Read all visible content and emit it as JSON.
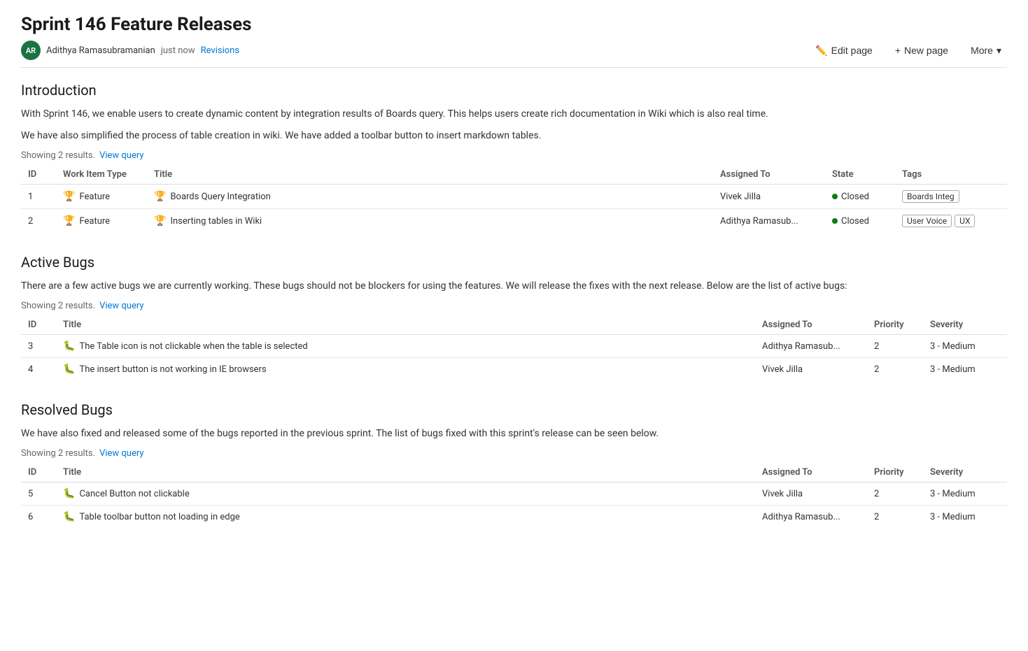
{
  "page": {
    "title": "Sprint 146 Feature Releases"
  },
  "meta": {
    "avatar_initials": "AR",
    "author": "Adithya Ramasubramanian",
    "timestamp": "just now",
    "revisions_label": "Revisions",
    "edit_page_label": "Edit page",
    "new_page_label": "New page",
    "more_label": "More"
  },
  "introduction": {
    "section_title": "Introduction",
    "paragraphs": [
      "With Sprint 146, we enable users to create dynamic content by integration results of Boards query. This helps users create rich documentation in Wiki which is also real time.",
      "We have also simplified the process of table creation in wiki. We have added a toolbar button to insert markdown tables."
    ],
    "query_info": "Showing 2 results.",
    "view_query_label": "View query",
    "columns": {
      "id": "ID",
      "work_item_type": "Work Item Type",
      "title": "Title",
      "assigned_to": "Assigned To",
      "state": "State",
      "tags": "Tags"
    },
    "rows": [
      {
        "id": "1",
        "type": "Feature",
        "type_icon": "feature",
        "title": "Boards Query Integration",
        "assigned_to": "Vivek Jilla",
        "state": "Closed",
        "tags": [
          "Boards Integ"
        ]
      },
      {
        "id": "2",
        "type": "Feature",
        "type_icon": "feature",
        "title": "Inserting tables in Wiki",
        "assigned_to": "Adithya Ramasub...",
        "state": "Closed",
        "tags": [
          "User Voice",
          "UX"
        ]
      }
    ]
  },
  "active_bugs": {
    "section_title": "Active Bugs",
    "description": "There are a few active bugs we are currently working. These bugs should not be blockers for using the features. We will release the fixes with the next release. Below are the list of active bugs:",
    "query_info": "Showing 2 results.",
    "view_query_label": "View query",
    "columns": {
      "id": "ID",
      "title": "Title",
      "assigned_to": "Assigned To",
      "priority": "Priority",
      "severity": "Severity"
    },
    "rows": [
      {
        "id": "3",
        "type_icon": "bug",
        "title": "The Table icon is not clickable when the table is selected",
        "assigned_to": "Adithya Ramasub...",
        "priority": "2",
        "severity": "3 - Medium"
      },
      {
        "id": "4",
        "type_icon": "bug",
        "title": "The insert button is not working in IE browsers",
        "assigned_to": "Vivek Jilla",
        "priority": "2",
        "severity": "3 - Medium"
      }
    ]
  },
  "resolved_bugs": {
    "section_title": "Resolved Bugs",
    "description": "We have also fixed and released some of the bugs reported in the previous sprint. The list of bugs fixed with this sprint's release can be seen below.",
    "query_info": "Showing 2 results.",
    "view_query_label": "View query",
    "columns": {
      "id": "ID",
      "title": "Title",
      "assigned_to": "Assigned To",
      "priority": "Priority",
      "severity": "Severity"
    },
    "rows": [
      {
        "id": "5",
        "type_icon": "bug",
        "title": "Cancel Button not clickable",
        "assigned_to": "Vivek Jilla",
        "priority": "2",
        "severity": "3 - Medium"
      },
      {
        "id": "6",
        "type_icon": "bug",
        "title": "Table toolbar button not loading in edge",
        "assigned_to": "Adithya Ramasub...",
        "priority": "2",
        "severity": "3 - Medium"
      }
    ]
  }
}
